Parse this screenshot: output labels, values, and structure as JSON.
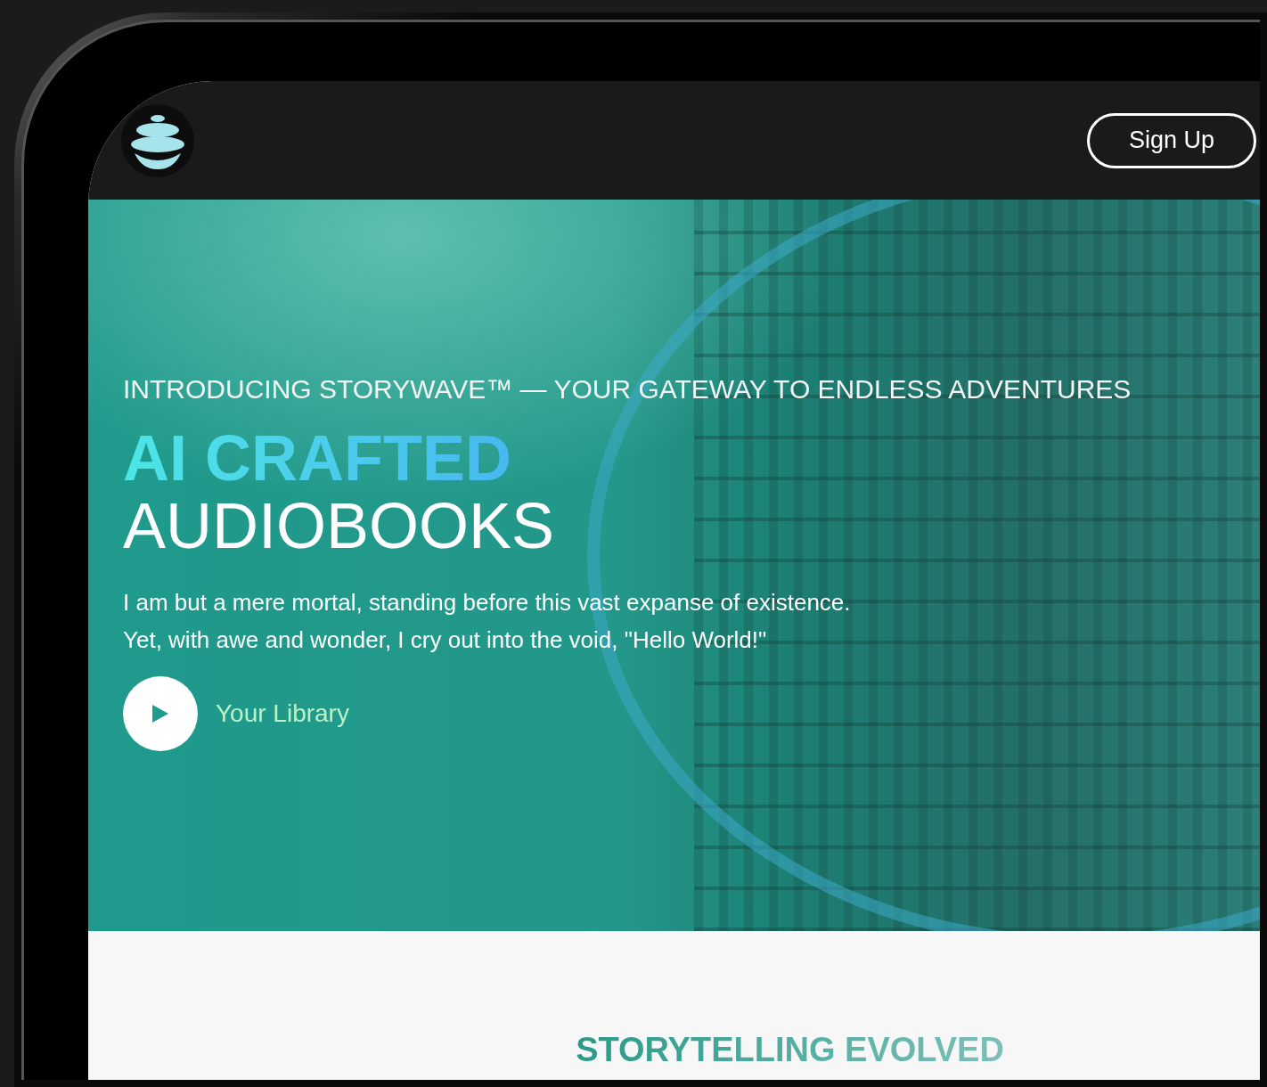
{
  "header": {
    "sign_up_button": "Sign Up"
  },
  "hero": {
    "eyebrow": "INTRODUCING STORYWAVE™ — YOUR GATEWAY TO ENDLESS ADVENTURES",
    "title_highlight": "AI CRAFTED",
    "title_rest": "AUDIOBOOKS",
    "description": "I am but a mere mortal, standing before this vast expanse of existence.\nYet, with awe and wonder, I cry out into the void, \"Hello World!\"",
    "play_link": "Your Library"
  },
  "section": {
    "title": "STORYTELLING EVOLVED"
  }
}
